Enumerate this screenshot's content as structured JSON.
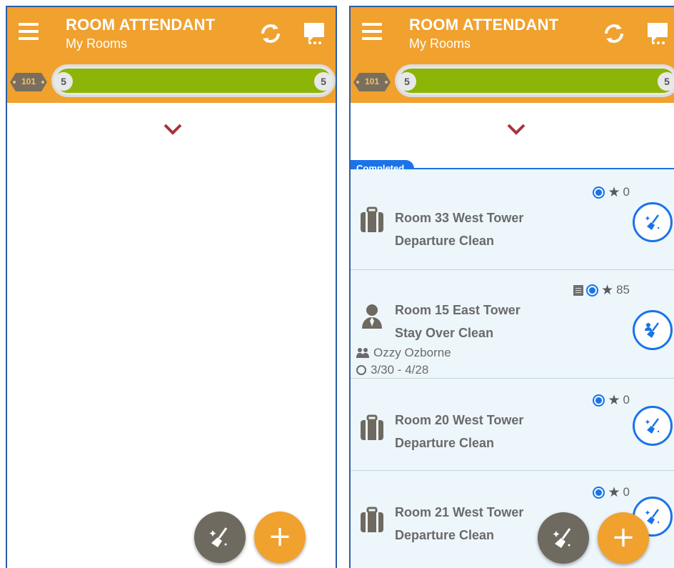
{
  "app": {
    "title": "ROOM ATTENDANT",
    "subtitle": "My Rooms"
  },
  "progress": {
    "badge": "101",
    "count_left": "5",
    "count_right": "5",
    "fraction_complete": 1.0
  },
  "colors": {
    "appbar": "#f0a12e",
    "progress_fill": "#8db507",
    "accent_blue": "#1a73e8",
    "card_bg": "#edf6fb",
    "fab_clean": "#6e6a60"
  },
  "icons": {
    "menu": "hamburger-icon",
    "sync": "sync-icon",
    "chat": "chat-icon",
    "expand": "chevron-down-icon",
    "clean": "broom-icon",
    "add": "plus-icon",
    "departure": "suitcase-icon",
    "stayover": "guest-person-icon"
  },
  "section": {
    "completed_label": "Completed"
  },
  "rooms": [
    {
      "room": "Room 33 West Tower",
      "service": "Departure Clean",
      "score": "0",
      "type": "departure",
      "has_note": false
    },
    {
      "room": "Room 15 East Tower",
      "service": "Stay Over Clean",
      "score": "85",
      "type": "stayover",
      "has_note": true,
      "guest": "Ozzy Ozborne",
      "dates": "3/30 - 4/28"
    },
    {
      "room": "Room 20 West Tower",
      "service": "Departure Clean",
      "score": "0",
      "type": "departure",
      "has_note": false
    },
    {
      "room": "Room 21 West Tower",
      "service": "Departure Clean",
      "score": "0",
      "type": "departure",
      "has_note": false
    }
  ],
  "fab": {
    "add_label": "+"
  }
}
